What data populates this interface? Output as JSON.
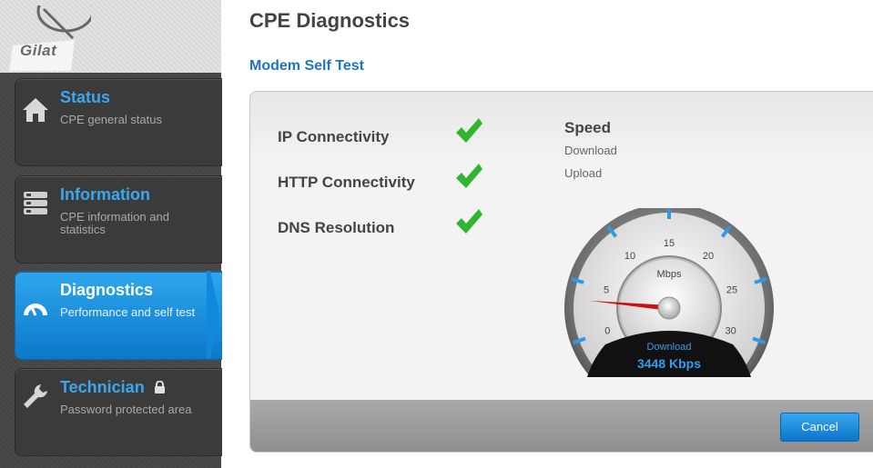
{
  "brand": {
    "name": "Gilat"
  },
  "sidebar": {
    "items": [
      {
        "title": "Status",
        "description": "CPE general status",
        "icon": "home-icon"
      },
      {
        "title": "Information",
        "description": "CPE information and statistics",
        "icon": "list-icon"
      },
      {
        "title": "Diagnostics",
        "description": "Performance and self test",
        "icon": "speedometer-icon",
        "active": true
      },
      {
        "title": "Technician",
        "description": "Password protected area",
        "icon": "wrench-icon",
        "badge_icon": "lock-icon"
      }
    ]
  },
  "header": {
    "title": "CPE Diagnostics",
    "subtitle": "Modem Self Test"
  },
  "tests": [
    {
      "label": "IP Connectivity",
      "status": "pass"
    },
    {
      "label": "HTTP Connectivity",
      "status": "pass"
    },
    {
      "label": "DNS Resolution",
      "status": "pass"
    }
  ],
  "speed": {
    "title": "Speed",
    "rows": [
      "Download",
      "Upload"
    ]
  },
  "gauge": {
    "unit": "Mbps",
    "ticks": [
      "0",
      "5",
      "10",
      "15",
      "20",
      "25",
      "30"
    ],
    "min": 0,
    "max": 30,
    "needle_value": 3.448,
    "mode_label": "Download",
    "readout": "3448 Kbps"
  },
  "footer": {
    "cancel_label": "Cancel"
  },
  "colors": {
    "accent": "#1f74c2",
    "active_nav": "#1a8fe0",
    "check": "#2fb52f",
    "needle": "#cc1111"
  }
}
